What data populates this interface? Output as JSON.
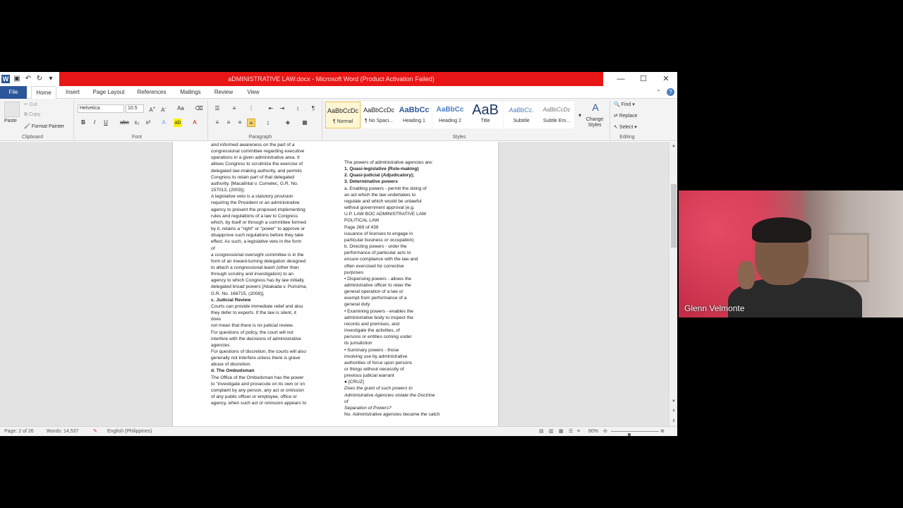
{
  "window": {
    "title": "aDMINISTRATIVE LAW.docx - Microsoft Word (Product Activation Failed)",
    "controls": {
      "minimize": "—",
      "maximize": "☐",
      "close": "✕"
    }
  },
  "tabs": [
    "File",
    "Home",
    "Insert",
    "Page Layout",
    "References",
    "Mailings",
    "Review",
    "View"
  ],
  "ribbon": {
    "clipboard": {
      "paste": "Paste",
      "cut": "Cut",
      "copy": "Copy",
      "format_painter": "Format Painter",
      "label": "Clipboard"
    },
    "font": {
      "name": "Helvetica",
      "size": "10.5",
      "label": "Font"
    },
    "paragraph": {
      "label": "Paragraph"
    },
    "styles": {
      "label": "Styles",
      "items": [
        {
          "preview": "AaBbCcDc",
          "name": "¶ Normal"
        },
        {
          "preview": "AaBbCcDc",
          "name": "¶ No Spaci..."
        },
        {
          "preview": "AaBbCc",
          "name": "Heading 1"
        },
        {
          "preview": "AaBbCc",
          "name": "Heading 2"
        },
        {
          "preview": "AaB",
          "name": "Title"
        },
        {
          "preview": "AaBbCc.",
          "name": "Subtitle"
        },
        {
          "preview": "AaBbCcDc",
          "name": "Subtle Em..."
        }
      ],
      "change": "Change Styles"
    },
    "editing": {
      "find": "Find",
      "replace": "Replace",
      "select": "Select",
      "label": "Editing"
    }
  },
  "document": {
    "left_column": [
      "and informed awareness on the part of a",
      "congressional committee regarding executive",
      "operations in a given administrative area. It",
      "allows Congress to scrutinize the exercise of",
      "delegated law-making authority, and permits",
      "Congress to retain part of that delegated",
      "authority. [Macalintal v. Comelec, G.R. No.",
      "157013, (2003)].",
      "A legislative veto is a statutory provision",
      "requiring the President or an administrative",
      "agency to present the proposed implementing",
      "rules and regulations of a law to Congress",
      "which, by itself or through a committee formed",
      "by it, retains a \"right\" or \"power\" to approve or",
      "disapprove such regulations before they take",
      "effect. As such, a legislative veto in the form",
      "of",
      "a congressional oversight committee is in the",
      "form of an inward-turning delegation designed",
      "to attach a congressional leash (other than",
      "through scrutiny and investigation) to an",
      "agency to which Congress has by law initially",
      "delegated broad powers [Abakada v. Purisima,",
      "G.R. No. 166715, (2008)].",
      "c. Judicial Review",
      "Courts can provide immediate relief and also",
      "they defer to experts. If the law is silent, it",
      "does",
      "not mean that there is no judicial review.",
      "For questions of policy, the court will not",
      "interfere with the decisions of administrative",
      "agencies.",
      "For questions of discretion, the courts will also",
      "generally not interfere unless there is grave",
      "abuse of discretion.",
      "d. The Ombudsman",
      "The Office of the Ombudsman has the power",
      "to \"investigate and prosecute on its own or on",
      "complaint by any person, any act or omission",
      "of any public officer or employee, office or",
      "agency, when such act or omission appears to"
    ],
    "right_column": [
      "The powers of administrative agencies are:",
      "1. Quasi-legislative (Rule-making)",
      "2. Quasi-judicial (Adjudicatory);",
      "3. Determinative powers",
      "a. Enabling powers - permit the doing of",
      "an act which the law undertakes to",
      "regulate and which would be unlawful",
      "without government approval (e.g.",
      "U.P. LAW BOC ADMINISTRATIVE LAW",
      "POLITICAL LAW",
      "Page 269 of 439",
      "issuance of licenses to engage in",
      "particular business or occupation)",
      "b. Directing powers - order the",
      "performance of particular acts to",
      "ensure compliance with the law and",
      "often exercised for corrective",
      "purposes",
      "• Dispensing powers - allows the",
      "administrative officer to relax the",
      "general operation of a law or",
      "exempt from performance of a",
      "general duty",
      "• Examining powers - enables the",
      "administrative body to inspect the",
      "records and premises, and",
      "investigate the activities, of",
      "persons or entities coming under",
      "its jurisdiction",
      "• Summary powers - those",
      "involving use by administrative",
      "authorities of force upon persons",
      "or things without necessity of",
      "previous judicial warrant",
      "● [CRUZ]",
      "Does the grant of such powers to",
      "Administrative Agencies violate the Doctrine",
      "of",
      "Separation of Powers?",
      "No. Administrative agencies became the catch"
    ]
  },
  "status": {
    "page": "Page: 2 of 26",
    "words": "Words: 14,537",
    "language": "English (Philippines)",
    "zoom": "80%"
  },
  "video": {
    "participant": "Glenn Velmonte"
  }
}
